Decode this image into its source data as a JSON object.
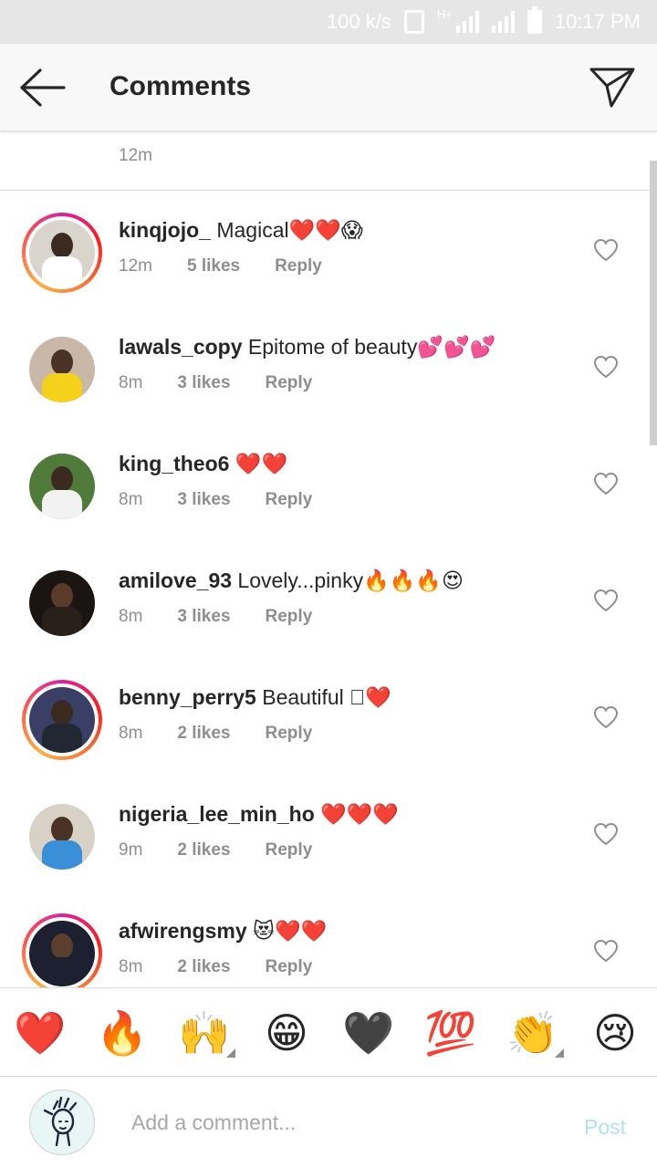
{
  "status_bar": {
    "net_speed": "100 k/s",
    "network_type": "H+",
    "time": "10:17 PM"
  },
  "header": {
    "title": "Comments",
    "back_icon": "arrow-left-icon",
    "send_icon": "paper-plane-icon"
  },
  "caption": {
    "time": "12m"
  },
  "comments": [
    {
      "username": "kinqjojo_",
      "text": "Magical❤️❤️😱",
      "time": "12m",
      "likes": "5 likes",
      "reply": "Reply",
      "story_ring": true,
      "avatar_bg": "#d9d4cc",
      "skin": "#3b2a20",
      "shirt": "#ffffff"
    },
    {
      "username": "lawals_copy",
      "text": "Epitome of beauty💕💕💕",
      "time": "8m",
      "likes": "3 likes",
      "reply": "Reply",
      "story_ring": false,
      "avatar_bg": "#c9b8a8",
      "skin": "#4a3226",
      "shirt": "#f4d21b"
    },
    {
      "username": "king_theo6",
      "text": "❤️❤️",
      "time": "8m",
      "likes": "3 likes",
      "reply": "Reply",
      "story_ring": false,
      "avatar_bg": "#4f7a3a",
      "skin": "#3b2a20",
      "shirt": "#f2f2f2"
    },
    {
      "username": "amilove_93",
      "text": "Lovely...pinky🔥🔥🔥😍",
      "time": "8m",
      "likes": "3 likes",
      "reply": "Reply",
      "story_ring": false,
      "avatar_bg": "#1b1512",
      "skin": "#5a3a28",
      "shirt": "#2a201a"
    },
    {
      "username": "benny_perry5",
      "text": "Beautiful 🏿❤️",
      "time": "8m",
      "likes": "2 likes",
      "reply": "Reply",
      "story_ring": true,
      "avatar_bg": "#3a3f66",
      "skin": "#3b2a20",
      "shirt": "#222831"
    },
    {
      "username": "nigeria_lee_min_ho",
      "text": "❤️❤️❤️",
      "time": "9m",
      "likes": "2 likes",
      "reply": "Reply",
      "story_ring": false,
      "avatar_bg": "#d8d2c6",
      "skin": "#4a3226",
      "shirt": "#3a8fd8"
    },
    {
      "username": "afwirengsmy",
      "text": "😻❤️❤️",
      "time": "8m",
      "likes": "2 likes",
      "reply": "Reply",
      "story_ring": true,
      "avatar_bg": "#1c2030",
      "skin": "#5a3e2e",
      "shirt": "#1c2030"
    }
  ],
  "emoji_bar": [
    {
      "emoji": "❤️",
      "name": "red-heart",
      "has_variants": false
    },
    {
      "emoji": "🔥",
      "name": "fire",
      "has_variants": false
    },
    {
      "emoji": "🙌",
      "name": "raising-hands",
      "has_variants": true
    },
    {
      "emoji": "😁",
      "name": "grinning-face",
      "has_variants": false
    },
    {
      "emoji": "🖤",
      "name": "black-heart",
      "has_variants": false
    },
    {
      "emoji": "💯",
      "name": "hundred-points",
      "has_variants": false
    },
    {
      "emoji": "👏",
      "name": "clapping-hands",
      "has_variants": true
    },
    {
      "emoji": "😢",
      "name": "crying-face",
      "has_variants": false
    }
  ],
  "composer": {
    "placeholder": "Add a comment...",
    "post_label": "Post"
  },
  "colors": {
    "story_ring": "#d6249f",
    "post_disabled": "#b2dffc",
    "secondary_text": "#8e8e8e"
  }
}
